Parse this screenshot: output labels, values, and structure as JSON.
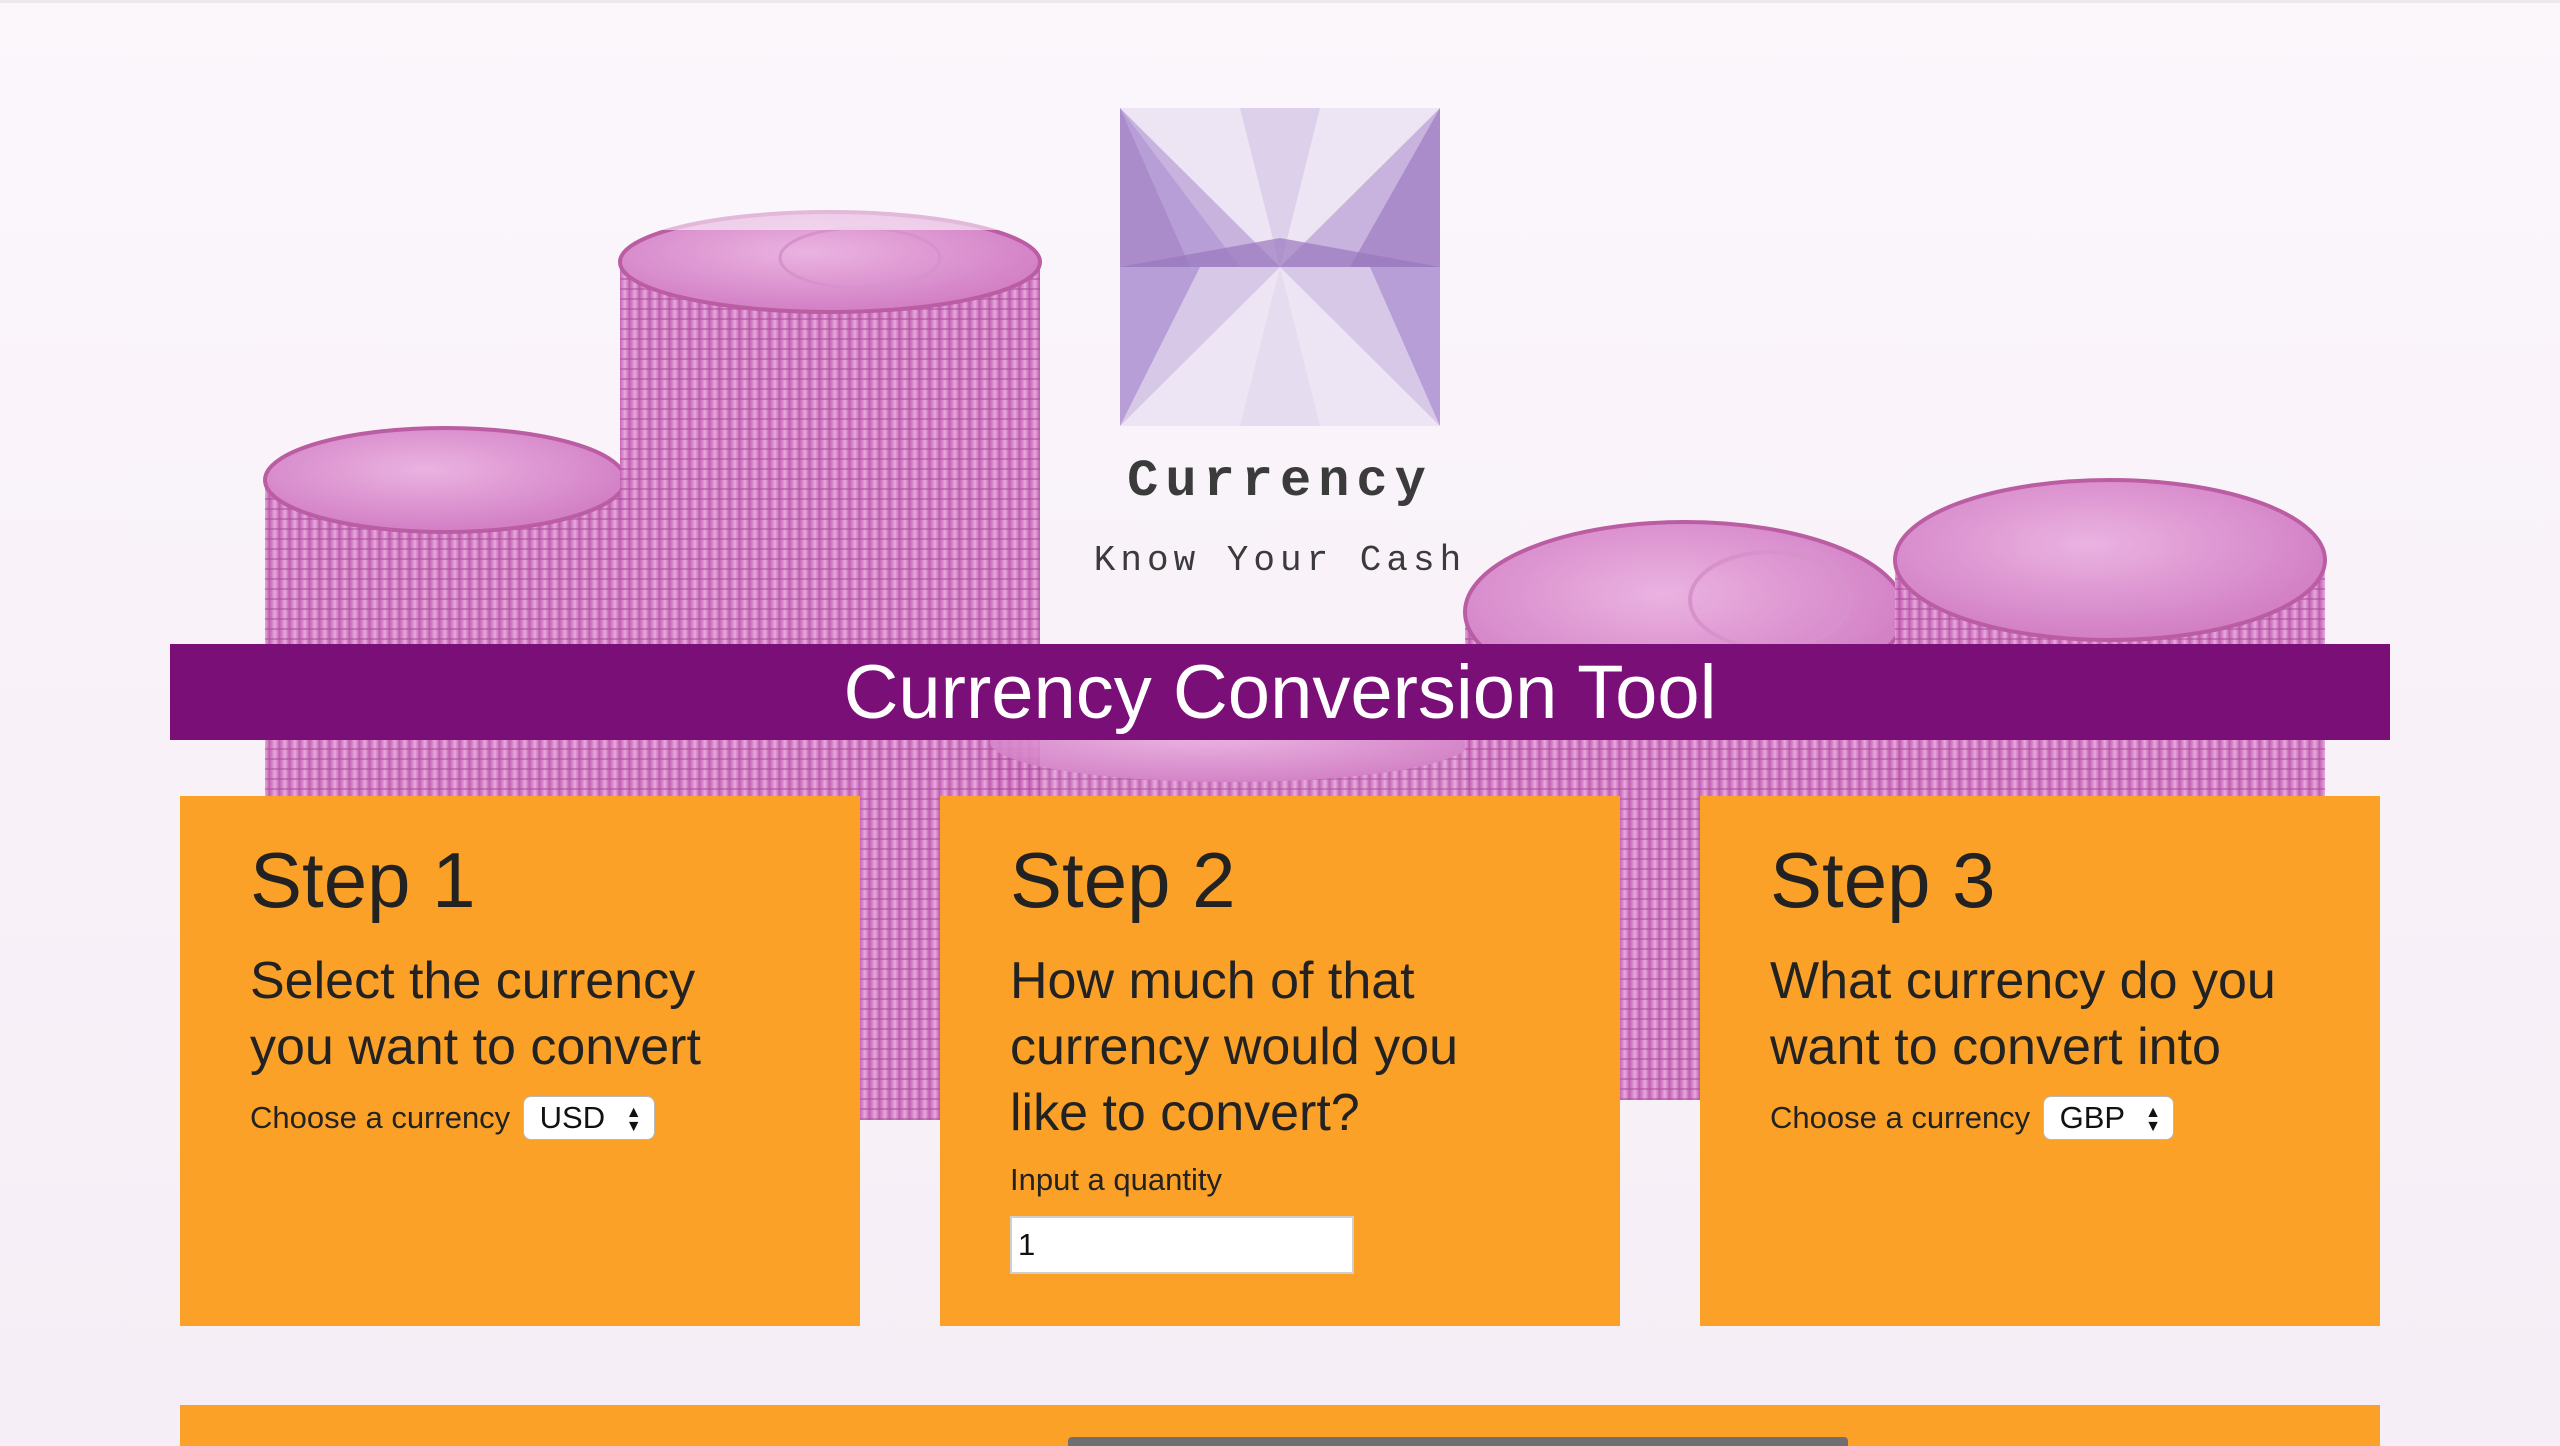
{
  "header": {
    "brand": "Currency",
    "tagline": "Know Your Cash"
  },
  "title": "Currency Conversion Tool",
  "steps": [
    {
      "heading": "Step 1",
      "question": "Select the currency you want to convert",
      "field_label": "Choose a currency",
      "selected": "USD"
    },
    {
      "heading": "Step 2",
      "question": "How much of that currency would you like to convert?",
      "field_label": "Input a quantity",
      "value": "1"
    },
    {
      "heading": "Step 3",
      "question": "What currency do you want to convert into",
      "field_label": "Choose a currency",
      "selected": "GBP"
    }
  ],
  "colors": {
    "title_bar": "#7a0f78",
    "card": "#fba128",
    "coin": "#d277c4",
    "logo": "#a98cc9"
  }
}
